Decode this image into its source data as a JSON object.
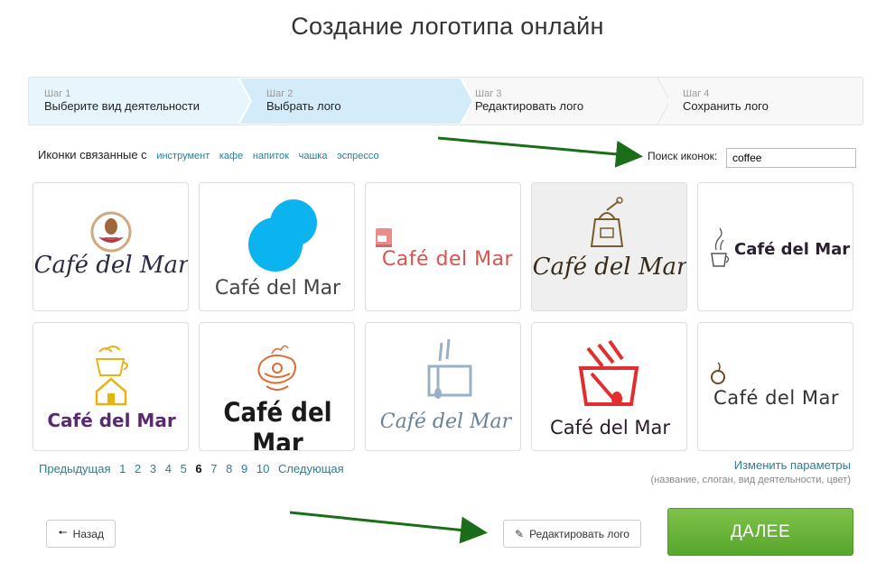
{
  "page": {
    "title": "Создание логотипа онлайн"
  },
  "steps": [
    {
      "num": "Шаг 1",
      "label": "Выберите вид деятельности"
    },
    {
      "num": "Шаг 2",
      "label": "Выбрать лого"
    },
    {
      "num": "Шаг 3",
      "label": "Редактировать лого"
    },
    {
      "num": "Шаг 4",
      "label": "Сохранить лого"
    }
  ],
  "colors": {
    "step_active": "#d6eefb",
    "step_done": "#e7f5fd",
    "link": "#2c7f92",
    "next_button": "#6ab53b"
  },
  "related": {
    "label": "Иконки связанные с",
    "tags": [
      "инструмент",
      "кафе",
      "напиток",
      "чашка",
      "эспрессо"
    ]
  },
  "search": {
    "label": "Поиск иконок:",
    "value": "coffee"
  },
  "logos": [
    {
      "text": "Café del Mar",
      "icon": "coffee-bean-circle-icon"
    },
    {
      "text": "Café del Mar",
      "icon": "blue-circles-icon"
    },
    {
      "text": "Café del Mar",
      "icon": "coffee-machine-icon"
    },
    {
      "text": "Café del Mar",
      "icon": "coffee-grinder-icon",
      "selected": true
    },
    {
      "text": "Café del Mar",
      "icon": "steaming-cup-icon"
    },
    {
      "text": "Café del Mar",
      "icon": "coffee-house-icon"
    },
    {
      "text": "Café del Mar",
      "icon": "ornate-cup-icon"
    },
    {
      "text": "Café del Mar",
      "icon": "cup-spoon-outline-icon"
    },
    {
      "text": "Café del Mar",
      "icon": "red-cup-spoon-icon"
    },
    {
      "text": "Café del Mar",
      "icon": "small-cup-icon"
    }
  ],
  "pagination": {
    "prev": "Предыдущая",
    "pages": [
      "1",
      "2",
      "3",
      "4",
      "5",
      "6",
      "7",
      "8",
      "9",
      "10"
    ],
    "current": "6",
    "next": "Следующая"
  },
  "params": {
    "link": "Изменить параметры",
    "hint": "(название, слоган, вид деятельности, цвет)"
  },
  "buttons": {
    "back": "Назад",
    "edit": "Редактировать лого",
    "next": "ДАЛЕЕ"
  }
}
